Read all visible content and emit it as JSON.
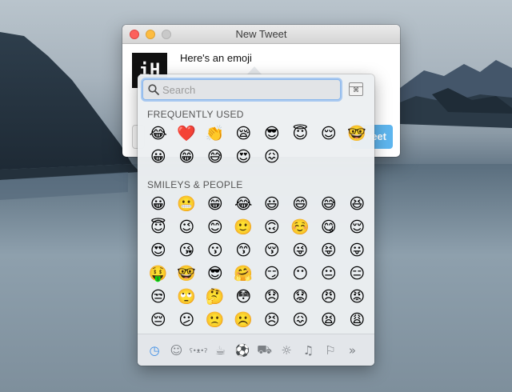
{
  "window": {
    "title": "New Tweet",
    "avatar_text": "iH",
    "tweet_text": "Here's an emoji",
    "tweet_button_label": "Tweet"
  },
  "emoji_picker": {
    "search_placeholder": "Search",
    "keyboard_viewer_symbol": "⌘",
    "sections": [
      {
        "title": "FREQUENTLY USED",
        "emojis": [
          "😂",
          "❤️",
          "👏",
          "😪",
          "😎",
          "😇",
          "😌",
          "🤓",
          "😀",
          "😁",
          "😅",
          "😍",
          "😖"
        ]
      },
      {
        "title": "SMILEYS & PEOPLE",
        "emojis": [
          "😀",
          "😬",
          "😁",
          "😂",
          "😃",
          "😄",
          "😅",
          "😆",
          "😇",
          "😉",
          "😊",
          "🙂",
          "🙃",
          "☺️",
          "😋",
          "😌",
          "😍",
          "😘",
          "😗",
          "😙",
          "😚",
          "😜",
          "😝",
          "😛",
          "🤑",
          "🤓",
          "😎",
          "🤗",
          "😏",
          "😶",
          "😐",
          "😑",
          "😒",
          "🙄",
          "🤔",
          "😳",
          "😞",
          "😟",
          "😠",
          "😡",
          "😔",
          "😕",
          "🙁",
          "☹️",
          "😣",
          "😖",
          "😫",
          "😩",
          "😤",
          "😮",
          "😱",
          "😨",
          "😰",
          "😯",
          "😦",
          "😧"
        ]
      }
    ],
    "categories": [
      {
        "name": "clock-icon",
        "glyph": "◷",
        "active": true
      },
      {
        "name": "smiley-icon",
        "glyph": "☺",
        "active": false
      },
      {
        "name": "bear-icon",
        "glyph": "ʕ•ᴥ•ʔ",
        "active": false
      },
      {
        "name": "food-icon",
        "glyph": "☕",
        "active": false
      },
      {
        "name": "ball-icon",
        "glyph": "⚽",
        "active": false
      },
      {
        "name": "car-icon",
        "glyph": "⛟",
        "active": false
      },
      {
        "name": "lightbulb-icon",
        "glyph": "☼",
        "active": false
      },
      {
        "name": "symbols-icon",
        "glyph": "♫",
        "active": false
      },
      {
        "name": "flag-icon",
        "glyph": "⚐",
        "active": false
      },
      {
        "name": "more-categories-icon",
        "glyph": "»",
        "active": false
      }
    ],
    "colors": {
      "accent": "#3d8ee6",
      "tweet_button": "#5eb6ef"
    }
  }
}
